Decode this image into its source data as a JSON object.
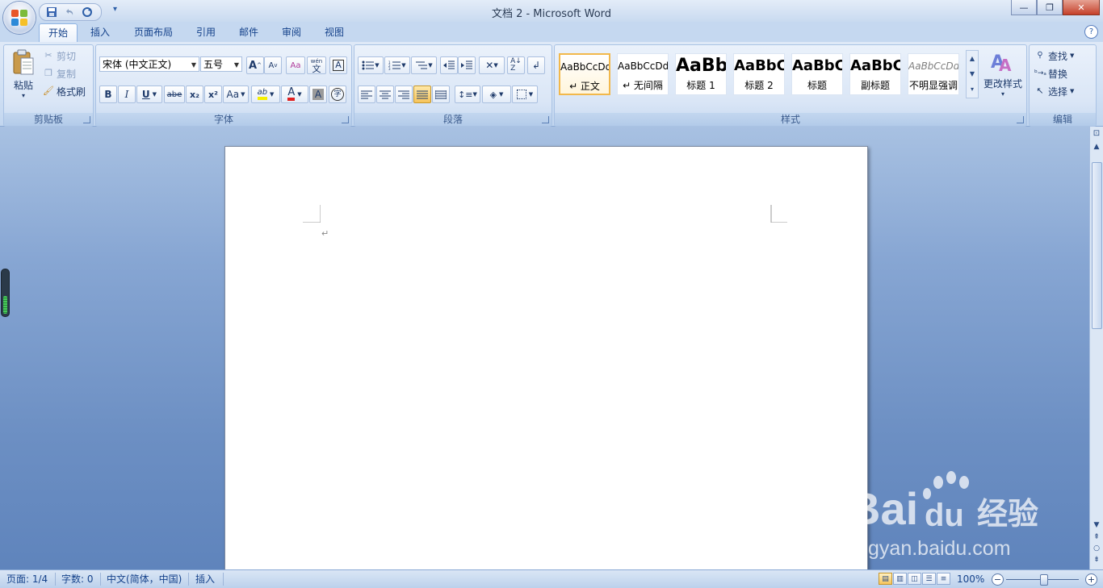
{
  "app": {
    "title": "文档 2 - Microsoft Word"
  },
  "tabs": [
    "开始",
    "插入",
    "页面布局",
    "引用",
    "邮件",
    "审阅",
    "视图"
  ],
  "clipboard": {
    "paste": "粘贴",
    "cut": "剪切",
    "copy": "复制",
    "format_painter": "格式刷",
    "label": "剪贴板"
  },
  "font": {
    "family": "宋体 (中文正文)",
    "size": "五号",
    "label": "字体",
    "bold": "B",
    "italic": "I",
    "underline": "U",
    "strike": "abe",
    "sub": "x₂",
    "sup": "x²",
    "case": "Aa",
    "grow": "A",
    "shrink": "A",
    "phonetic": "wén",
    "phonetic_char": "文",
    "border_char": "A",
    "shade_char": "A",
    "enclose_char": "字",
    "highlight": "ab",
    "color": "A"
  },
  "paragraph": {
    "label": "段落"
  },
  "styles": {
    "label": "样式",
    "change": "更改样式",
    "items": [
      {
        "sample": "AaBbCcDd",
        "name": "↵ 正文"
      },
      {
        "sample": "AaBbCcDd",
        "name": "↵ 无间隔"
      },
      {
        "sample": "AaBb",
        "name": "标题 1"
      },
      {
        "sample": "AaBbC",
        "name": "标题 2"
      },
      {
        "sample": "AaBbC",
        "name": "标题"
      },
      {
        "sample": "AaBbC",
        "name": "副标题"
      },
      {
        "sample": "AaBbCcDd",
        "name": "不明显强调"
      }
    ]
  },
  "editing": {
    "find": "查找",
    "replace": "替换",
    "select": "选择",
    "label": "编辑"
  },
  "document": {
    "paragraph_mark": "↵"
  },
  "status": {
    "page": "页面: 1/4",
    "words": "字数: 0",
    "language": "中文(简体，中国)",
    "mode": "插入",
    "zoom": "100%"
  },
  "watermark": {
    "brand_a": "Bai",
    "brand_b": "du",
    "brand_cn": "经验",
    "url": "jingyan.baidu.com"
  },
  "colors": {
    "highlight": "#f7f000",
    "font_color": "#e02020",
    "accent": "#15428b"
  }
}
